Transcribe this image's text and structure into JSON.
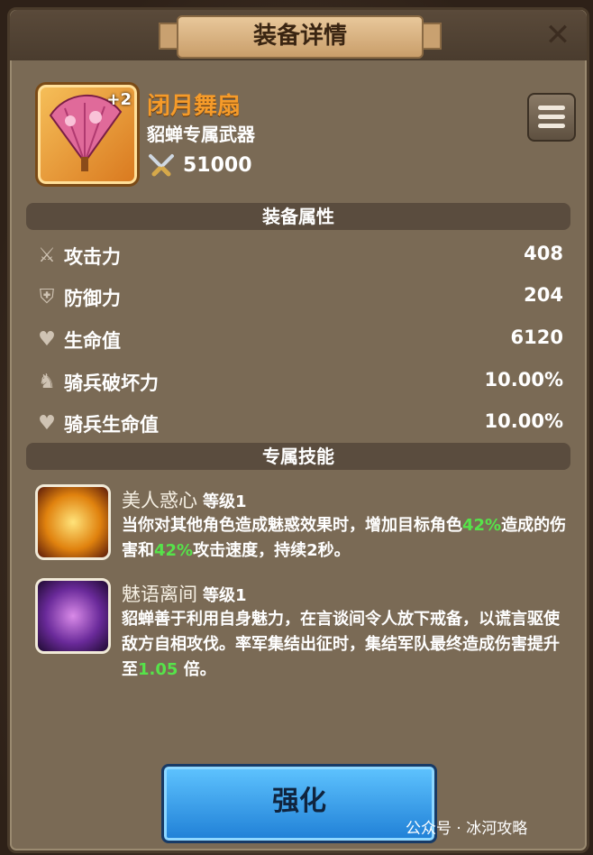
{
  "header": {
    "title": "装备详情"
  },
  "item": {
    "name": "闭月舞扇",
    "plus": "+2",
    "subtitle": "貂蝉专属武器",
    "power": "51000"
  },
  "sections": {
    "attributes": "装备属性",
    "skills": "专属技能"
  },
  "stats": [
    {
      "label": "攻击力",
      "value": "408"
    },
    {
      "label": "防御力",
      "value": "204"
    },
    {
      "label": "生命值",
      "value": "6120"
    },
    {
      "label": "骑兵破坏力",
      "value": "10.00%"
    },
    {
      "label": "骑兵生命值",
      "value": "10.00%"
    }
  ],
  "skills": [
    {
      "name": "美人惑心",
      "level": "等级1",
      "desc": [
        "当你对其他角色造成魅惑效果时，增加目标角色",
        "42%",
        "造成的伤害和",
        "42%",
        "攻击速度，持续2秒。"
      ]
    },
    {
      "name": "魅语离间",
      "level": "等级1",
      "desc": [
        "貂蝉善于利用自身魅力，在言谈间令人放下戒备，以谎言驱使敌方自相攻伐。率军集结出征时，集结军队最终造成伤害提升至",
        "1.05",
        " 倍。"
      ]
    }
  ],
  "button": {
    "enhance": "强化"
  },
  "watermark": "公众号 · 冰河攻略",
  "colors": {
    "accent_orange": "#f59b2a",
    "highlight_green": "#56e34a",
    "button_blue": "#1f7fd6"
  }
}
